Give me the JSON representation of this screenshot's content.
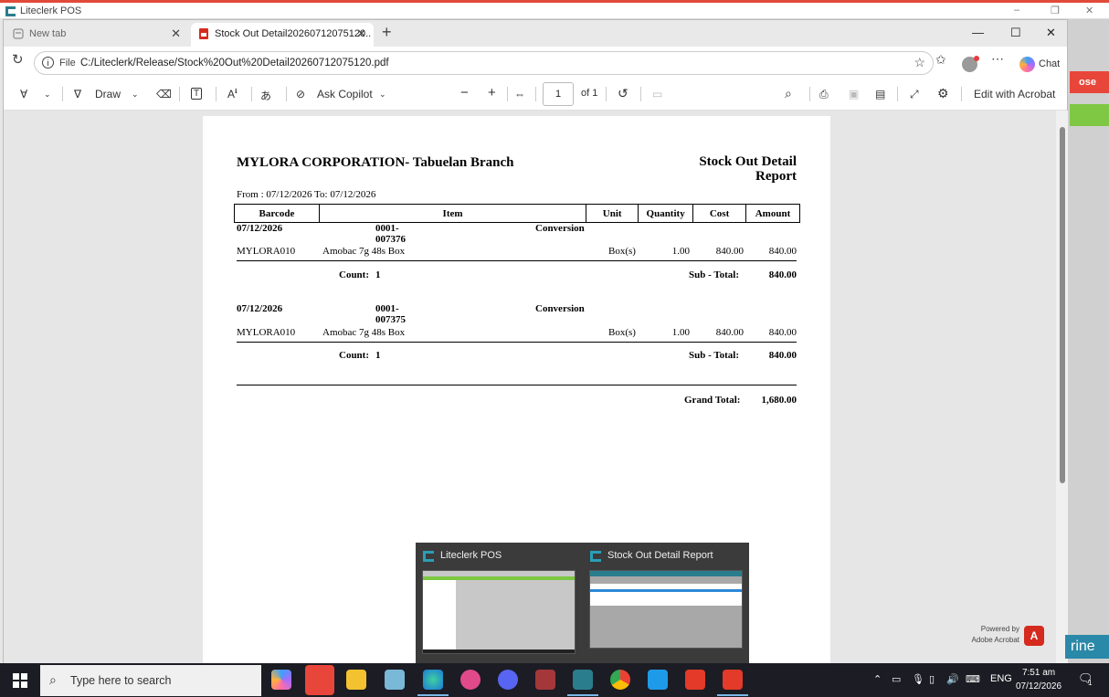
{
  "background_app": {
    "title": "Liteclerk POS",
    "close_label": "ose",
    "teal_label": "rine"
  },
  "browser": {
    "tabs": [
      {
        "label": "New tab"
      },
      {
        "label": "Stock Out Detail20260712075120.."
      }
    ],
    "address": {
      "scheme_label": "File",
      "url": "C:/Liteclerk/Release/Stock%20Out%20Detail20260712075120.pdf"
    },
    "chat_label": "Chat"
  },
  "pdf_toolbar": {
    "draw_label": "Draw",
    "ask_copilot_label": "Ask Copilot",
    "page_number": "1",
    "page_total": "of 1",
    "edit_acrobat_label": "Edit with Acrobat"
  },
  "report": {
    "company": "MYLORA CORPORATION- Tabuelan Branch",
    "title_line1": "Stock Out Detail",
    "title_line2": "Report",
    "date_range": "From : 07/12/2026 To: 07/12/2026",
    "columns": [
      "Barcode",
      "Item",
      "Unit",
      "Quantity",
      "Cost",
      "Amount"
    ],
    "groups": [
      {
        "date": "07/12/2026",
        "ref_line1": "0001-",
        "ref_line2": "007376",
        "type": "Conversion",
        "row": {
          "barcode": "MYLORA010",
          "item": "Amobac 7g 48s Box",
          "unit": "Box(s)",
          "quantity": "1.00",
          "cost": "840.00",
          "amount": "840.00"
        },
        "count_label": "Count:",
        "count": "1",
        "subtotal_label": "Sub - Total:",
        "subtotal": "840.00"
      },
      {
        "date": "07/12/2026",
        "ref_line1": "0001-",
        "ref_line2": "007375",
        "type": "Conversion",
        "row": {
          "barcode": "MYLORA010",
          "item": "Amobac 7g 48s Box",
          "unit": "Box(s)",
          "quantity": "1.00",
          "cost": "840.00",
          "amount": "840.00"
        },
        "count_label": "Count:",
        "count": "1",
        "subtotal_label": "Sub - Total:",
        "subtotal": "840.00"
      }
    ],
    "grand_total_label": "Grand Total:",
    "grand_total": "1,680.00"
  },
  "acrobat_badge": {
    "line1": "Powered by",
    "line2": "Adobe Acrobat"
  },
  "taskbar_preview": [
    {
      "title": "Liteclerk POS"
    },
    {
      "title": "Stock Out Detail Report"
    }
  ],
  "taskbar": {
    "search_placeholder": "Type here to search",
    "language": "ENG",
    "time": "7:51 am",
    "date": "07/12/2026",
    "notification_count": "1"
  },
  "colors": {
    "accent_red": "#e04a3a",
    "acrobat_red": "#d52b1e",
    "teal": "#2a9fb8",
    "green": "#7ec843"
  }
}
